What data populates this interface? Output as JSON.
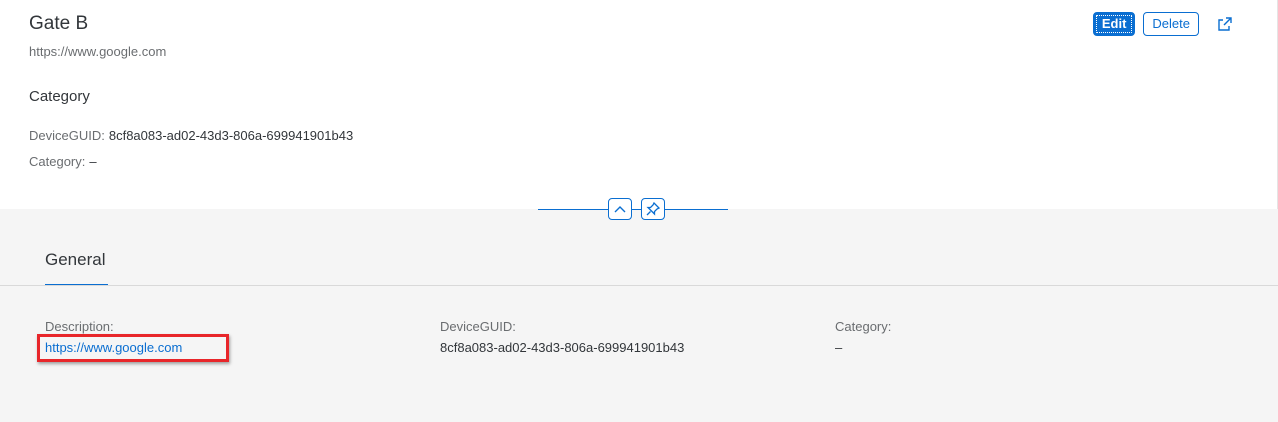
{
  "header": {
    "title": "Gate B",
    "subtitle": "https://www.google.com",
    "section_heading": "Category",
    "fields": [
      {
        "label": "DeviceGUID:",
        "value": "8cf8a083-ad02-43d3-806a-699941901b43"
      },
      {
        "label": "Category:",
        "value": "–"
      }
    ]
  },
  "actions": {
    "edit_label": "Edit",
    "delete_label": "Delete",
    "share_icon": "share-icon"
  },
  "toggles": {
    "collapse_icon": "chevron-up-icon",
    "pin_icon": "pin-icon"
  },
  "tabs": [
    {
      "label": "General",
      "selected": true
    }
  ],
  "general": {
    "fields": [
      {
        "label": "Description:",
        "value": "https://www.google.com"
      },
      {
        "label": "DeviceGUID:",
        "value": "8cf8a083-ad02-43d3-806a-699941901b43"
      },
      {
        "label": "Category:",
        "value": "–"
      }
    ]
  },
  "colors": {
    "accent": "#0a6ed1",
    "highlight": "#e8262a",
    "text": "#32363a",
    "muted": "#6a6d70"
  }
}
